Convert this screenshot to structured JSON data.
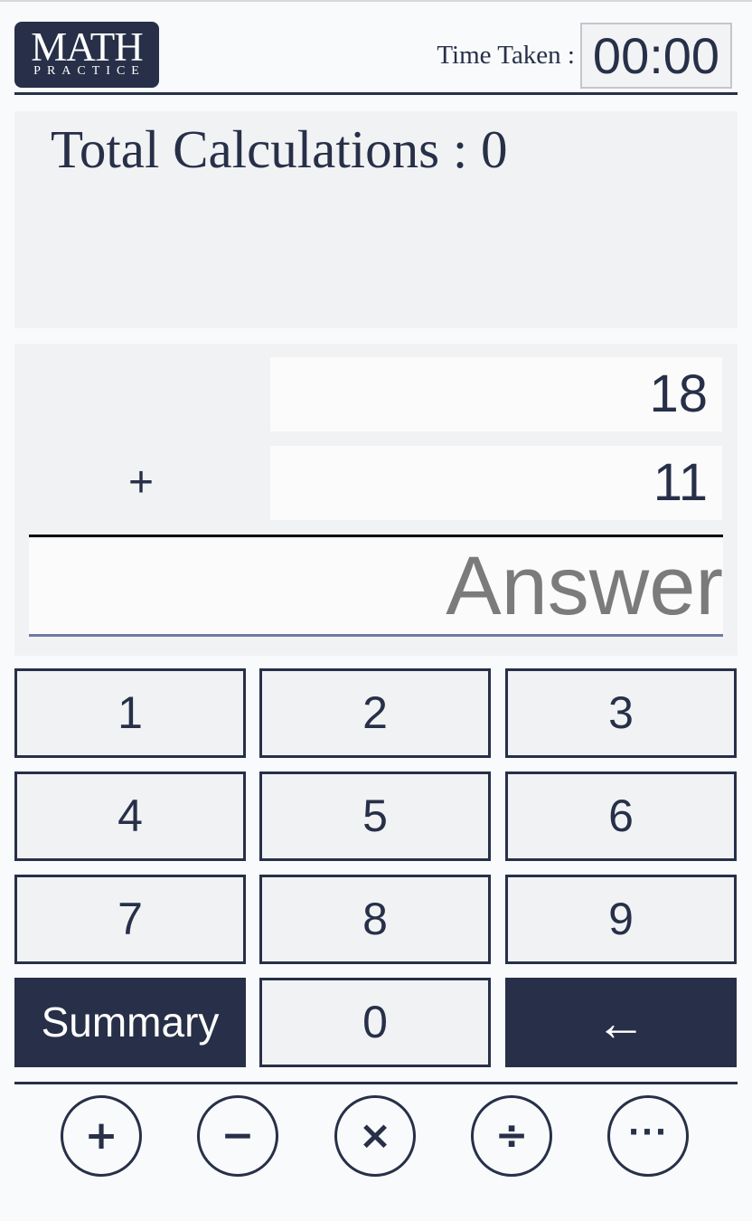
{
  "header": {
    "logo_main": "MATH",
    "logo_sub": "PRACTICE",
    "timer_label": "Time Taken :",
    "timer_value": "00:00"
  },
  "stats": {
    "label": "Total Calculations",
    "separator": " : ",
    "count": "0"
  },
  "problem": {
    "operand1": "18",
    "operand2": "11",
    "operator": "+",
    "answer_value": "",
    "answer_placeholder": "Answer"
  },
  "keypad": {
    "keys": [
      "1",
      "2",
      "3",
      "4",
      "5",
      "6",
      "7",
      "8",
      "9"
    ],
    "summary": "Summary",
    "zero": "0",
    "backspace": "←"
  },
  "operations": {
    "add": "+",
    "subtract": "−",
    "multiply": "×",
    "divide": "÷",
    "more": "···"
  },
  "colors": {
    "primary": "#273048",
    "panel": "#f1f2f4",
    "background": "#f9fafb",
    "answer_underline": "#6b7da0"
  }
}
